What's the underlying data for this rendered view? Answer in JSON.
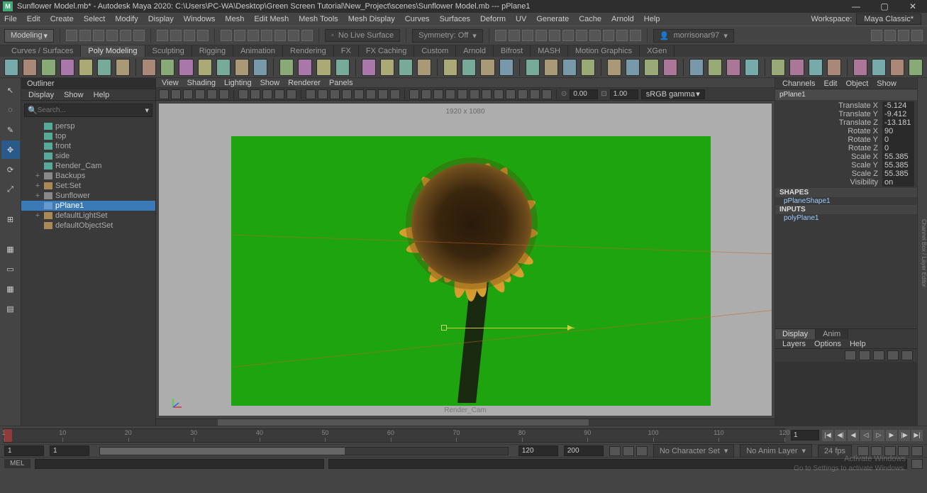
{
  "title": "Sunflower Model.mb* - Autodesk Maya 2020: C:\\Users\\PC-WA\\Desktop\\Green Screen Tutorial\\New_Project\\scenes\\Sunflower Model.mb  ---  pPlane1",
  "mainmenu": {
    "items": [
      "File",
      "Edit",
      "Create",
      "Select",
      "Modify",
      "Display",
      "Windows",
      "Mesh",
      "Edit Mesh",
      "Mesh Tools",
      "Mesh Display",
      "Curves",
      "Surfaces",
      "Deform",
      "UV",
      "Generate",
      "Cache",
      "Arnold",
      "Help"
    ],
    "workspace_label": "Workspace:",
    "workspace_value": "Maya Classic*"
  },
  "toolbar": {
    "mode": "Modeling",
    "live": "No Live Surface",
    "sym": "Symmetry: Off",
    "user": "morrisonar97"
  },
  "shelftabs": [
    "Curves / Surfaces",
    "Poly Modeling",
    "Sculpting",
    "Rigging",
    "Animation",
    "Rendering",
    "FX",
    "FX Caching",
    "Custom",
    "Arnold",
    "Bifrost",
    "MASH",
    "Motion Graphics",
    "XGen"
  ],
  "shelftab_active": 1,
  "outliner": {
    "title": "Outliner",
    "menu": [
      "Display",
      "Show",
      "Help"
    ],
    "search_placeholder": "Search...",
    "items": [
      {
        "name": "persp",
        "icon": "cam",
        "depth": 1
      },
      {
        "name": "top",
        "icon": "cam",
        "depth": 1
      },
      {
        "name": "front",
        "icon": "cam",
        "depth": 1
      },
      {
        "name": "side",
        "icon": "cam",
        "depth": 1
      },
      {
        "name": "Render_Cam",
        "icon": "cam",
        "depth": 1
      },
      {
        "name": "Backups",
        "icon": "grp",
        "depth": 1,
        "expand": "+"
      },
      {
        "name": "Set:Set",
        "icon": "set",
        "depth": 1,
        "expand": "+"
      },
      {
        "name": "Sunflower",
        "icon": "grp",
        "depth": 1,
        "expand": "+"
      },
      {
        "name": "pPlane1",
        "icon": "mesh",
        "depth": 1,
        "sel": true
      },
      {
        "name": "defaultLightSet",
        "icon": "set",
        "depth": 1,
        "expand": "+"
      },
      {
        "name": "defaultObjectSet",
        "icon": "set",
        "depth": 1
      }
    ]
  },
  "viewport": {
    "menu": [
      "View",
      "Shading",
      "Lighting",
      "Show",
      "Renderer",
      "Panels"
    ],
    "res": "1920 x 1080",
    "cam": "Render_Cam",
    "near": "0.00",
    "far": "1.00",
    "gamma": "sRGB gamma"
  },
  "channel": {
    "menu": [
      "Channels",
      "Edit",
      "Object",
      "Show"
    ],
    "node": "pPlane1",
    "attrs": [
      {
        "label": "Translate X",
        "val": "-5.124"
      },
      {
        "label": "Translate Y",
        "val": "-9.412"
      },
      {
        "label": "Translate Z",
        "val": "-13.181"
      },
      {
        "label": "Rotate X",
        "val": "90"
      },
      {
        "label": "Rotate Y",
        "val": "0"
      },
      {
        "label": "Rotate Z",
        "val": "0"
      },
      {
        "label": "Scale X",
        "val": "55.385"
      },
      {
        "label": "Scale Y",
        "val": "55.385"
      },
      {
        "label": "Scale Z",
        "val": "55.385"
      },
      {
        "label": "Visibility",
        "val": "on"
      }
    ],
    "shapes_label": "SHAPES",
    "shape": "pPlaneShape1",
    "inputs_label": "INPUTS",
    "input": "polyPlane1"
  },
  "layers": {
    "tabs": [
      "Display",
      "Anim"
    ],
    "menu": [
      "Layers",
      "Options",
      "Help"
    ]
  },
  "timeline": {
    "start": "1",
    "end": "120",
    "curframe": "1",
    "range_start": "1",
    "range_end": "200",
    "range_inner_start": "1",
    "range_inner_end": "120",
    "ticks": [
      1,
      10,
      20,
      30,
      40,
      50,
      60,
      70,
      80,
      90,
      100,
      110,
      120
    ],
    "nochar": "No Character Set",
    "noanim": "No Anim Layer",
    "fps": "24 fps"
  },
  "cmd": {
    "lang": "MEL"
  },
  "watermark": {
    "line1": "Activate Windows",
    "line2": "Go to Settings to activate Windows."
  }
}
